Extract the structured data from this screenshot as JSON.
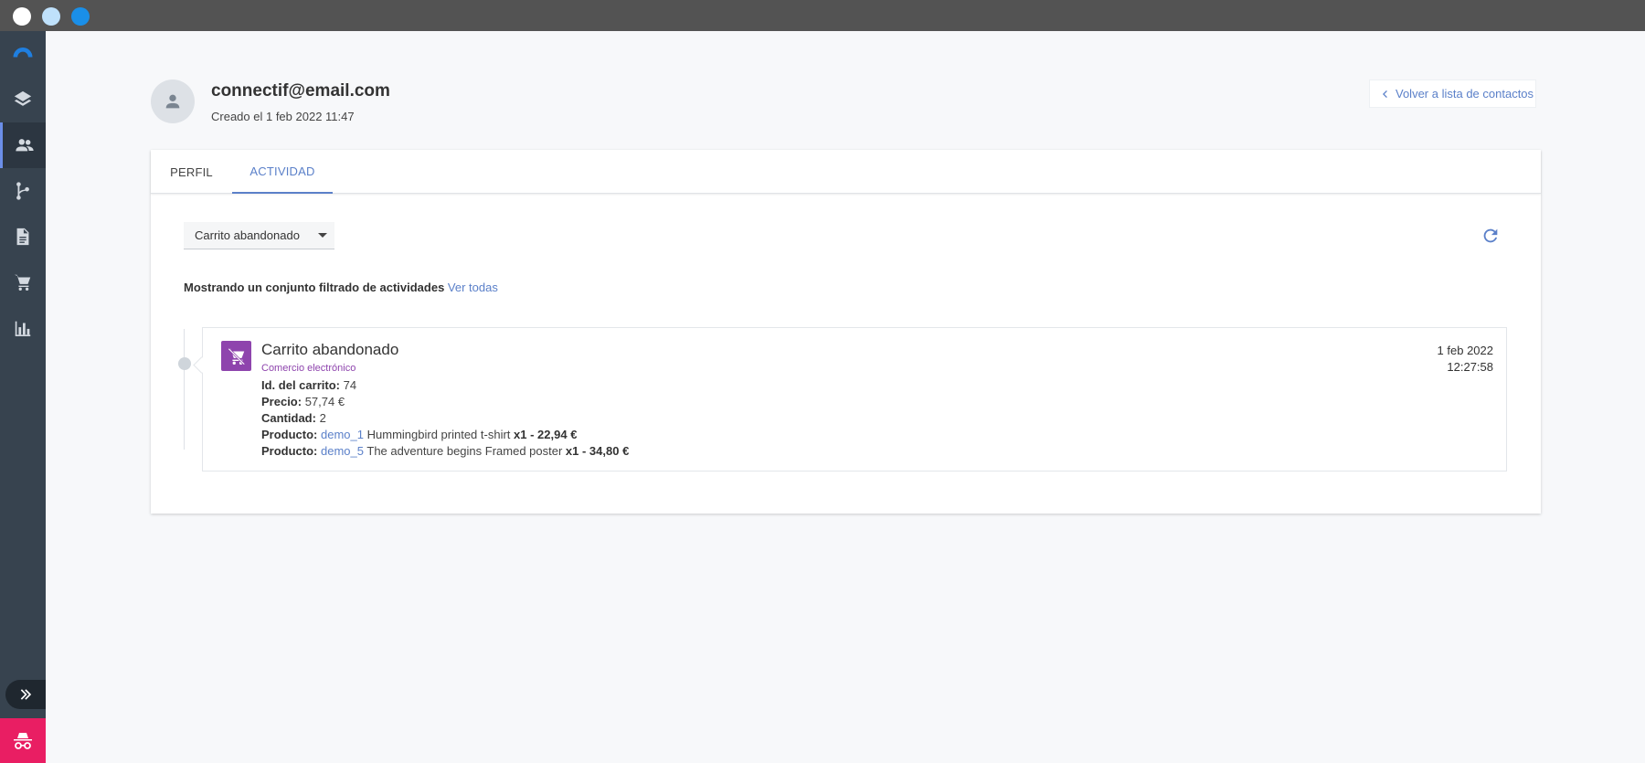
{
  "window": {
    "controls": [
      "close",
      "minimize",
      "maximize"
    ]
  },
  "sidebar": {
    "items": [
      {
        "name": "logo-icon",
        "active": false
      },
      {
        "name": "layers-icon",
        "active": false
      },
      {
        "name": "contacts-icon",
        "active": true
      },
      {
        "name": "workflow-icon",
        "active": false
      },
      {
        "name": "document-icon",
        "active": false
      },
      {
        "name": "cart-icon",
        "active": false
      },
      {
        "name": "chart-icon",
        "active": false
      }
    ],
    "expand_icon": "double-chevron-right-icon",
    "incognito_icon": "incognito-icon"
  },
  "header": {
    "email": "connectif@email.com",
    "created": "Creado el 1 feb 2022 11:47",
    "back_label": "Volver a lista de contactos"
  },
  "tabs": [
    {
      "label": "PERFIL",
      "active": false
    },
    {
      "label": "ACTIVIDAD",
      "active": true
    }
  ],
  "filter": {
    "selected": "Carrito abandonado",
    "note": "Mostrando un conjunto filtrado de actividades",
    "see_all": "Ver todas"
  },
  "activity": {
    "title": "Carrito abandonado",
    "category": "Comercio electrónico",
    "date": "1 feb 2022",
    "time": "12:27:58",
    "cart_id_label": "Id. del carrito:",
    "cart_id": "74",
    "price_label": "Precio:",
    "price": "57,74 €",
    "quantity_label": "Cantidad:",
    "quantity": "2",
    "products": [
      {
        "label": "Producto:",
        "id": "demo_1",
        "name": "Hummingbird printed t-shirt",
        "qty_price": "x1 - 22,94 €"
      },
      {
        "label": "Producto:",
        "id": "demo_5",
        "name": "The adventure begins Framed poster",
        "qty_price": "x1 - 34,80 €"
      }
    ]
  },
  "colors": {
    "accent": "#5b80c9",
    "sidebar": "#37434f",
    "activity_icon": "#8e44ad",
    "incognito": "#e91e63"
  }
}
